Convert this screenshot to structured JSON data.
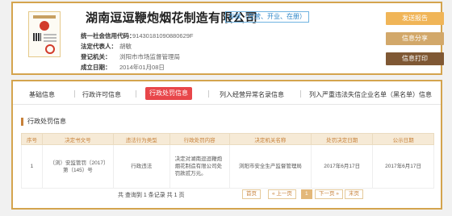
{
  "company": {
    "name": "湖南逗逗鞭炮烟花制造有限公司",
    "status": "存续（在营、开业、在册）",
    "credit_code_label": "统一社会信用代码：",
    "credit_code": "91430181090880629F",
    "legal_rep_label": "法定代表人：",
    "legal_rep": "胡敏",
    "authority_label": "登记机关：",
    "authority": "浏阳市市场监督管理局",
    "established_label": "成立日期：",
    "established": "2014年01月08日"
  },
  "actions": {
    "report": "发送报告",
    "share": "信息分享",
    "print": "信息打印"
  },
  "tabs": [
    {
      "label": "基础信息",
      "active": false
    },
    {
      "label": "行政许可信息",
      "active": false
    },
    {
      "label": "行政处罚信息",
      "active": true
    },
    {
      "label": "列入经营异常名录信息",
      "active": false
    },
    {
      "label": "列入严重违法失信企业名单（黑名单）信息",
      "active": false
    }
  ],
  "section_title": "行政处罚信息",
  "table": {
    "headers": [
      "序号",
      "决定书文号",
      "违法行为类型",
      "行政处罚内容",
      "决定机关名称",
      "处罚决定日期",
      "公示日期"
    ],
    "rows": [
      [
        "1",
        "（浏）安监管罚〔2017〕第（145）号",
        "行政违法",
        "决定对湖南逗逗鞭炮烟花制造有限公司处罚款贰万元。",
        "浏阳市安全生产监督管理局",
        "2017年6月17日",
        "2017年6月17日"
      ]
    ]
  },
  "pagination": {
    "summary": "共 查询到 1 条记录 共 1 页",
    "first": "首页",
    "prev": "« 上一页",
    "current": "1",
    "next": "下一页 »",
    "last": "末页"
  }
}
